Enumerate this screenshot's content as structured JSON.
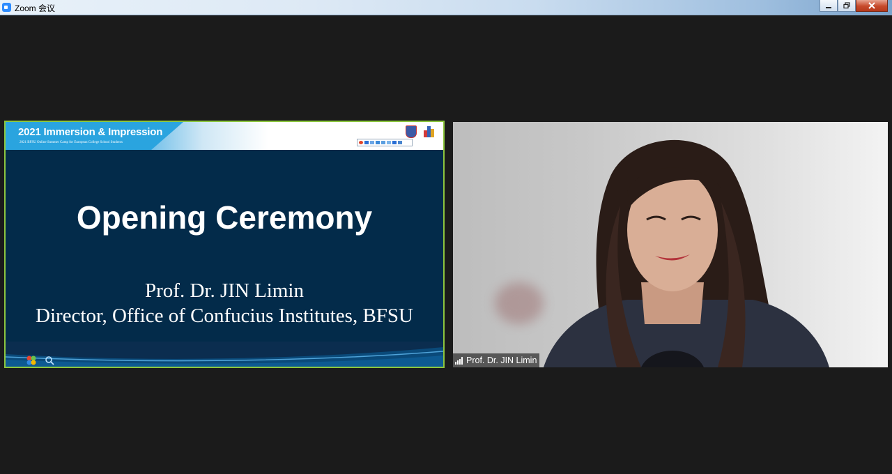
{
  "window": {
    "title": "Zoom 会议",
    "controls": [
      "minimize",
      "restore",
      "close"
    ]
  },
  "shared_screen": {
    "header": {
      "title": "2021 Immersion & Impression",
      "subtitle": "2021 BFSU Online Summer Camp for European College School Students"
    },
    "heading": "Opening Ceremony",
    "speaker_name": "Prof. Dr. JIN Limin",
    "speaker_role": "Director, Office of Confucius Institutes, BFSU",
    "border_color": "#8cc63f"
  },
  "video_tile": {
    "participant_name": "Prof. Dr. JIN Limin",
    "signal_icon": "signal-bars-icon"
  },
  "colors": {
    "background": "#1b1b1b",
    "slide_body": "#032b4a",
    "active_speaker_border": "#8cc63f"
  }
}
